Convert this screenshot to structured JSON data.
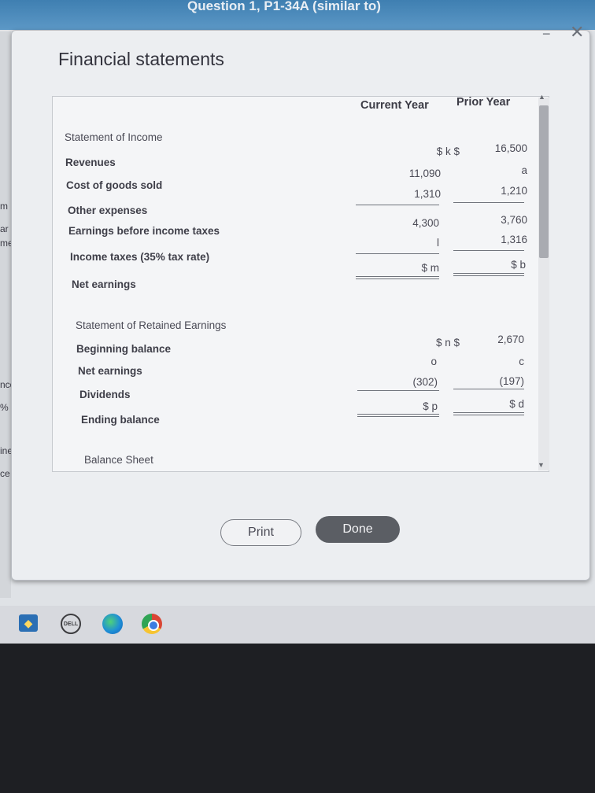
{
  "window": {
    "question_title": "Question 1, P1-34A (similar to)",
    "title": "Financial statements",
    "minimize_glyph": "−",
    "close_glyph": "✕"
  },
  "background_fragments": [
    "m",
    "ar",
    "me",
    "ncom",
    "% tax",
    "ined E",
    "ce"
  ],
  "columns": {
    "current": "Current Year",
    "prior": "Prior Year"
  },
  "income_statement": {
    "heading": "Statement of Income",
    "rows": [
      {
        "label": "Revenues",
        "current": "$ k $",
        "prior": "16,500"
      },
      {
        "label": "Cost of goods sold",
        "current": "11,090",
        "prior": "a"
      },
      {
        "label": "",
        "current": "1,310",
        "prior": "1,210"
      },
      {
        "label": "Other expenses",
        "current": "4,300",
        "prior": "3,760"
      },
      {
        "label": "Earnings before income taxes",
        "current": "l",
        "prior": "1,316"
      },
      {
        "label": "Income taxes (35% tax rate)",
        "current": "$ m",
        "prior": "$ b"
      },
      {
        "label": "Net earnings",
        "current": "",
        "prior": ""
      }
    ]
  },
  "retained_earnings": {
    "heading": "Statement of Retained Earnings",
    "rows": [
      {
        "label": "Beginning balance",
        "current": "$ n $",
        "prior": "2,670"
      },
      {
        "label": "Net earnings",
        "current": "o",
        "prior": "c"
      },
      {
        "label": "Dividends",
        "current": "(302)",
        "prior": "(197)"
      },
      {
        "label": "Ending balance",
        "current": "$ p",
        "prior": "$ d"
      }
    ]
  },
  "balance_sheet": {
    "heading": "Balance Sheet"
  },
  "buttons": {
    "print": "Print",
    "done": "Done"
  },
  "taskbar": {
    "dell_label": "DELL",
    "icons": [
      "store-icon",
      "dell-icon",
      "edge-icon",
      "chrome-icon"
    ]
  }
}
